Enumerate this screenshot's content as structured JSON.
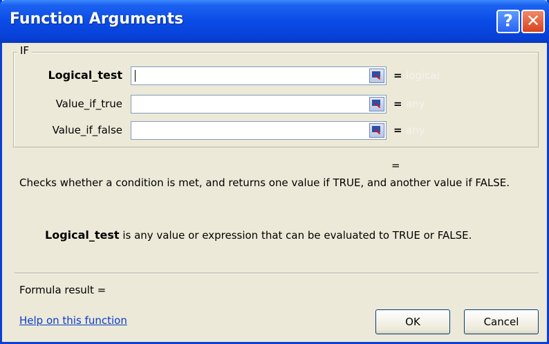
{
  "window": {
    "title": "Function Arguments",
    "help_glyph": "?",
    "close_glyph": "✕"
  },
  "function_group": {
    "name": "IF",
    "arguments": [
      {
        "label": "Logical_test",
        "value": "",
        "result_prefix": "=",
        "type_hint": "logical",
        "bold": true
      },
      {
        "label": "Value_if_true",
        "value": "",
        "result_prefix": "=",
        "type_hint": "any",
        "bold": false
      },
      {
        "label": "Value_if_false",
        "value": "",
        "result_prefix": "=",
        "type_hint": "any",
        "bold": false
      }
    ]
  },
  "function_result_prefix": "=",
  "description": "Checks whether a condition is met, and returns one value if TRUE, and another value if FALSE.",
  "argument_help": {
    "name": "Logical_test",
    "text": " is any value or expression that can be evaluated to TRUE or FALSE."
  },
  "formula_result_label": "Formula result =",
  "help_link": "Help on this function",
  "buttons": {
    "ok": "OK",
    "cancel": "Cancel"
  },
  "icons": [
    "help-icon",
    "close-icon",
    "collapse-dialog-icon"
  ],
  "colors": {
    "title_bar": "#0a4be6",
    "dialog_background": "#ece9d8",
    "link": "#0b3cc9",
    "close_button": "#d6441e"
  }
}
